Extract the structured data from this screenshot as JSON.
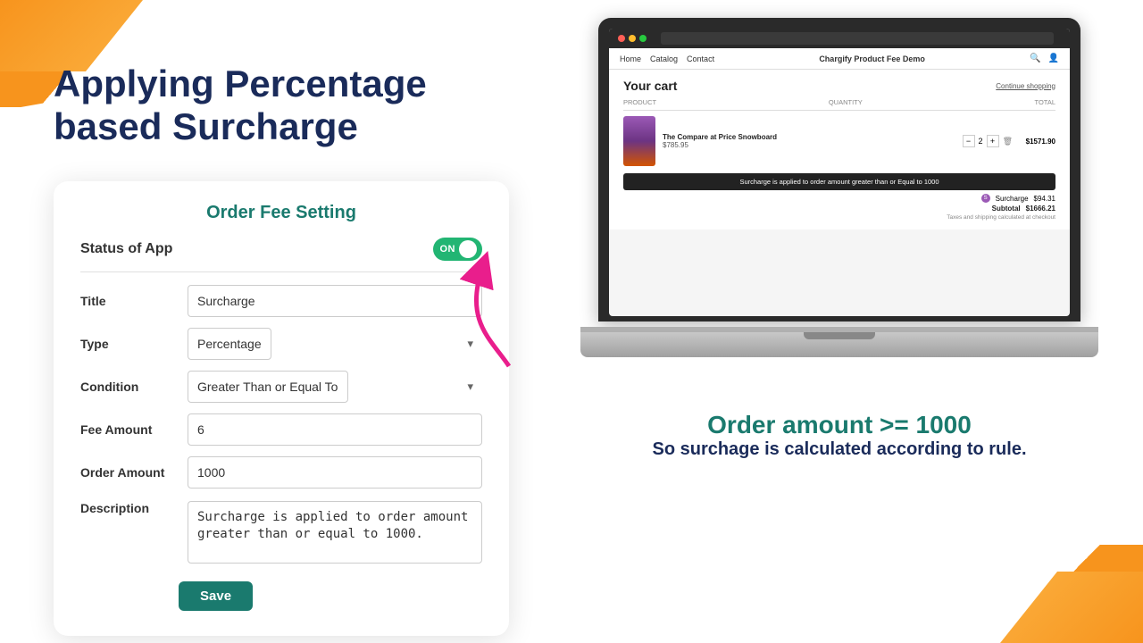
{
  "page": {
    "main_title_line1": "Applying Percentage",
    "main_title_line2": "based Surcharge"
  },
  "fee_card": {
    "title": "Order Fee Setting",
    "status_label": "Status of App",
    "toggle_text": "ON",
    "fields": {
      "title_label": "Title",
      "title_value": "Surcharge",
      "type_label": "Type",
      "type_value": "Percentage",
      "condition_label": "Condition",
      "condition_value": "Greater Than or Equal To",
      "fee_amount_label": "Fee Amount",
      "fee_amount_value": "6",
      "order_amount_label": "Order Amount",
      "order_amount_value": "1000",
      "description_label": "Description",
      "description_value": "Surcharge is applied to order amount greater than or equal to 1000."
    },
    "save_button": "Save"
  },
  "laptop": {
    "store_nav": {
      "links": [
        "Home",
        "Catalog",
        "Contact"
      ],
      "title": "Chargify Product Fee Demo"
    },
    "cart": {
      "title": "Your cart",
      "continue_shopping": "Continue shopping",
      "headers": [
        "PRODUCT",
        "QUANTITY",
        "TOTAL"
      ],
      "product_name": "The Compare at Price Snowboard",
      "product_price": "$785.95",
      "quantity": "2",
      "product_total": "$1571.90",
      "tooltip": "Surcharge is applied to order amount greater than or Equal to 1000",
      "surcharge_label": "Surcharge",
      "surcharge_amount": "$94.31",
      "subtotal_label": "Subtotal",
      "subtotal_amount": "$1666.21",
      "tax_note": "Taxes and shipping calculated at checkout"
    }
  },
  "bottom_text": {
    "line1": "Order amount >= 1000",
    "line2": "So surchage is calculated according to rule."
  },
  "colors": {
    "teal": "#1a7a6e",
    "navy": "#1a2b5a",
    "orange": "#f7941d"
  }
}
